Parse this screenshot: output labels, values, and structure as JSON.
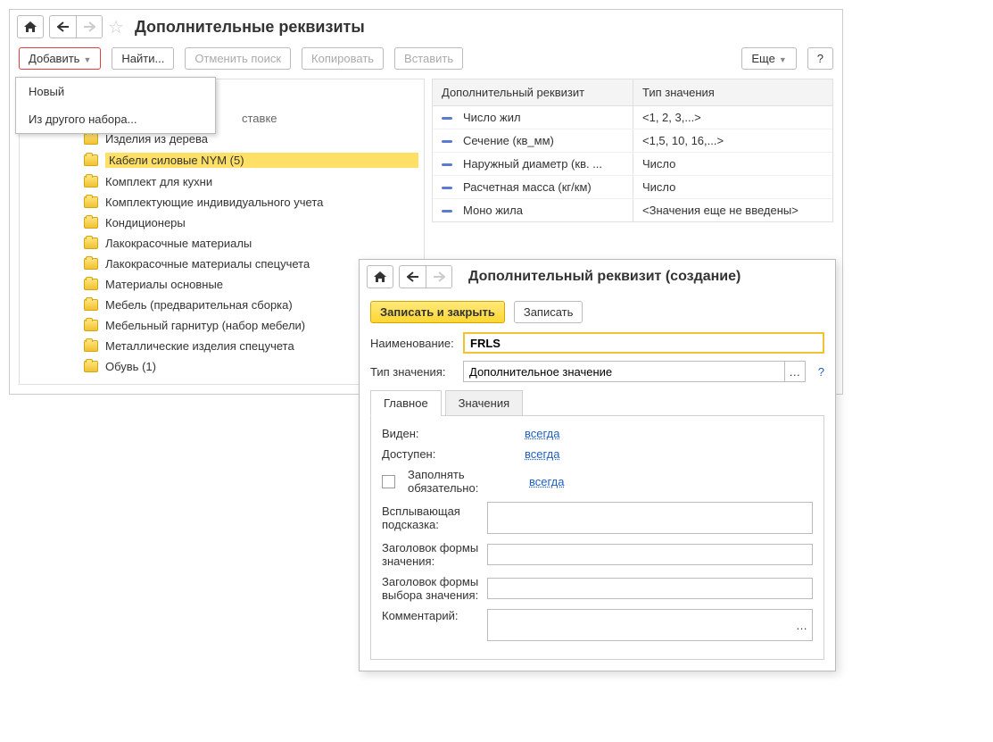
{
  "main": {
    "title": "Дополнительные реквизиты",
    "toolbar": {
      "add": "Добавить",
      "find": "Найти...",
      "cancel_search": "Отменить поиск",
      "copy": "Копировать",
      "paste": "Вставить",
      "more": "Еще",
      "help": "?"
    },
    "dropdown": {
      "new": "Новый",
      "from_other": "Из другого набора..."
    },
    "tree": {
      "partial": "ставке",
      "items": [
        "Изделия из дерева",
        "Кабели силовые NYM (5)",
        "Комплект для кухни",
        "Комплектующие индивидуального учета",
        "Кондиционеры",
        "Лакокрасочные материалы",
        "Лакокрасочные материалы спецучета",
        "Материалы основные",
        "Мебель (предварительная сборка)",
        "Мебельный гарнитур (набор мебели)",
        "Металлические изделия спецучета",
        "Обувь (1)"
      ]
    },
    "details": {
      "header_a": "Дополнительный реквизит",
      "header_b": "Тип значения",
      "rows": [
        {
          "a": "Число жил",
          "b": "<1, 2, 3,...>"
        },
        {
          "a": "Сечение (кв_мм)",
          "b": "<1,5, 10, 16,...>"
        },
        {
          "a": "Наружный диаметр (кв. ...",
          "b": "Число"
        },
        {
          "a": "Расчетная масса (кг/км)",
          "b": "Число"
        },
        {
          "a": "Моно жила",
          "b": "<Значения еще не введены>"
        }
      ]
    }
  },
  "popup": {
    "title": "Дополнительный реквизит (создание)",
    "toolbar": {
      "save_close": "Записать и закрыть",
      "save": "Записать"
    },
    "field_name_label": "Наименование:",
    "field_name_value": "FRLS",
    "value_type_label": "Тип значения:",
    "value_type_value": "Дополнительное значение",
    "help": "?",
    "tabs": {
      "main": "Главное",
      "values": "Значения"
    },
    "body": {
      "visible_label": "Виден:",
      "visible_value": "всегда",
      "available_label": "Доступен:",
      "available_value": "всегда",
      "required_label": "Заполнять обязательно:",
      "required_value": "всегда",
      "hint_label": "Всплывающая подсказка:",
      "form_title_label": "Заголовок формы значения:",
      "form_choice_title_label": "Заголовок формы выбора значения:",
      "comment_label": "Комментарий:"
    }
  }
}
